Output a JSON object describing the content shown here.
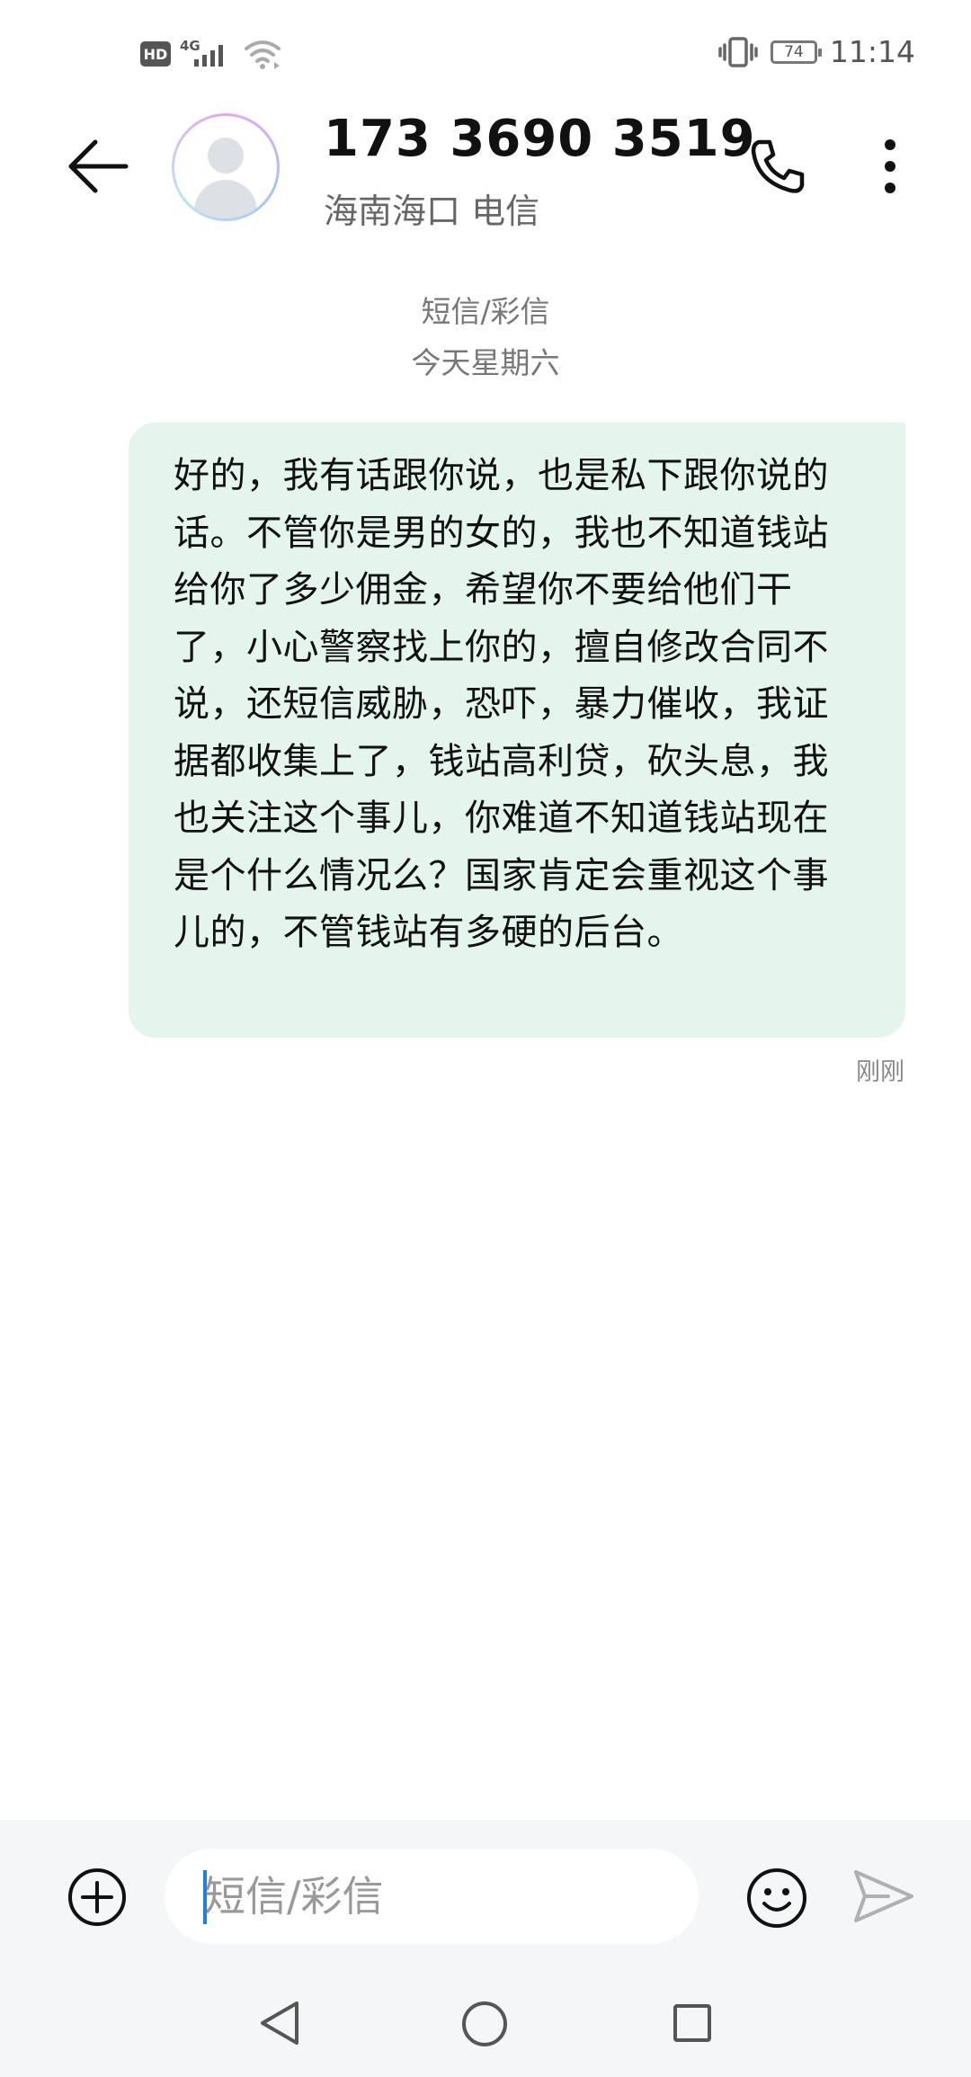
{
  "status_bar": {
    "hd_label": "HD",
    "network_label": "4G",
    "battery_level": "74",
    "time": "11:14"
  },
  "header": {
    "contact_number": "173 3690 3519",
    "contact_location": "海南海口 电信"
  },
  "conversation": {
    "type_label": "短信/彩信",
    "date_label": "今天星期六",
    "messages": [
      {
        "direction": "sent",
        "text": "好的，我有话跟你说，也是私下跟你说的话。不管你是男的女的，我也不知道钱站给你了多少佣金，希望你不要给他们干了，小心警察找上你的，擅自修改合同不说，还短信威胁，恐吓，暴力催收，我证据都收集上了，钱站高利贷，砍头息，我也关注这个事儿，你难道不知道钱站现在是个什么情况么？国家肯定会重视这个事儿的，不管钱站有多硬的后台。",
        "time": "刚刚"
      }
    ]
  },
  "input": {
    "placeholder": "短信/彩信",
    "value": ""
  },
  "colors": {
    "bubble_background": "#e4f5ed",
    "input_area_background": "#f5f6f7",
    "caret": "#1e7df0"
  }
}
